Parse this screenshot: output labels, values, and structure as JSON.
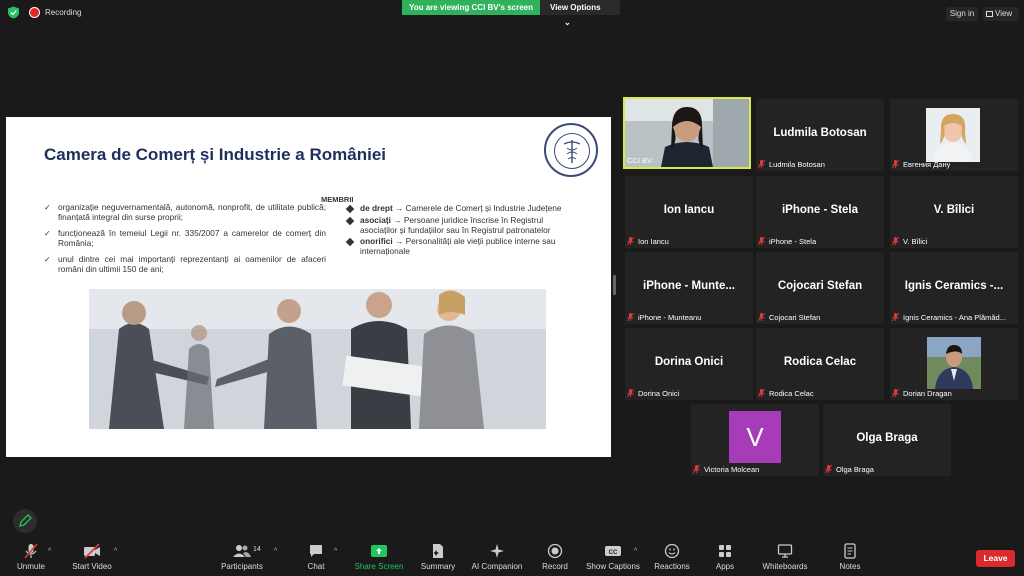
{
  "top": {
    "recording": "Recording",
    "viewing_banner": "You are viewing CCI BV's screen",
    "view_options": "View Options",
    "sign_in": "Sign in",
    "view": "View"
  },
  "slide": {
    "title": "Camera de Comerț și Industrie a României",
    "left_items": [
      "organizație neguvernamentală, autonomă, nonprofit, de utilitate publică; finanțată integral din surse proprii;",
      "funcționează în temeiul Legii nr. 335/2007 a camerelor de comerț din România;",
      "unul dintre cei mai importanți reprezentanți ai oamenilor de afaceri români din ultimii 150 de ani;"
    ],
    "members_heading": "MEMBRII",
    "members": [
      {
        "bold": "de drept",
        "text": "→ Camerele de Comerț și Industrie Județene"
      },
      {
        "bold": "asociați",
        "text": "→ Persoane juridice înscrise în Registrul asociaților și fundațiilor sau în Registrul patronatelor"
      },
      {
        "bold": "onorifici",
        "text": "→ Personalități ale vieții publice interne sau internaționale"
      }
    ]
  },
  "participants": [
    {
      "label": "CCI BV",
      "name": ""
    },
    {
      "label": "Ludmila Botosan",
      "name": "Ludmila Botosan"
    },
    {
      "label": "Евгения Дану",
      "name": ""
    },
    {
      "label": "Ion Iancu",
      "name": "Ion Iancu"
    },
    {
      "label": "iPhone - Stela",
      "name": "iPhone - Stela"
    },
    {
      "label": "V. Bîlici",
      "name": "V. Bîlici"
    },
    {
      "label": "iPhone - Munteanu",
      "name": "iPhone - Munte..."
    },
    {
      "label": "Cojocari Stefan",
      "name": "Cojocari Stefan"
    },
    {
      "label": "Ignis Ceramics - Ana Plămăd...",
      "name": "Ignis Ceramics -..."
    },
    {
      "label": "Dorina Onici",
      "name": "Dorina Onici"
    },
    {
      "label": "Rodica Celac",
      "name": "Rodica Celac"
    },
    {
      "label": "Dorian Dragan",
      "name": ""
    },
    {
      "label": "Victoria Molcean",
      "name": "",
      "initial": "V"
    },
    {
      "label": "Olga Braga",
      "name": "Olga Braga"
    }
  ],
  "toolbar": {
    "unmute": "Unmute",
    "start_video": "Start Video",
    "participants": "Participants",
    "participants_count": "14",
    "chat": "Chat",
    "share_screen": "Share Screen",
    "summary": "Summary",
    "ai_companion": "AI Companion",
    "record": "Record",
    "show_captions": "Show Captions",
    "reactions": "Reactions",
    "apps": "Apps",
    "whiteboards": "Whiteboards",
    "notes": "Notes",
    "leave": "Leave"
  },
  "colors": {
    "banner_green": "#2fb25b",
    "active_speaker": "#d9e84a",
    "leave_red": "#d92b2b",
    "share_green": "#23c55e",
    "slide_title": "#1e2f5e"
  }
}
